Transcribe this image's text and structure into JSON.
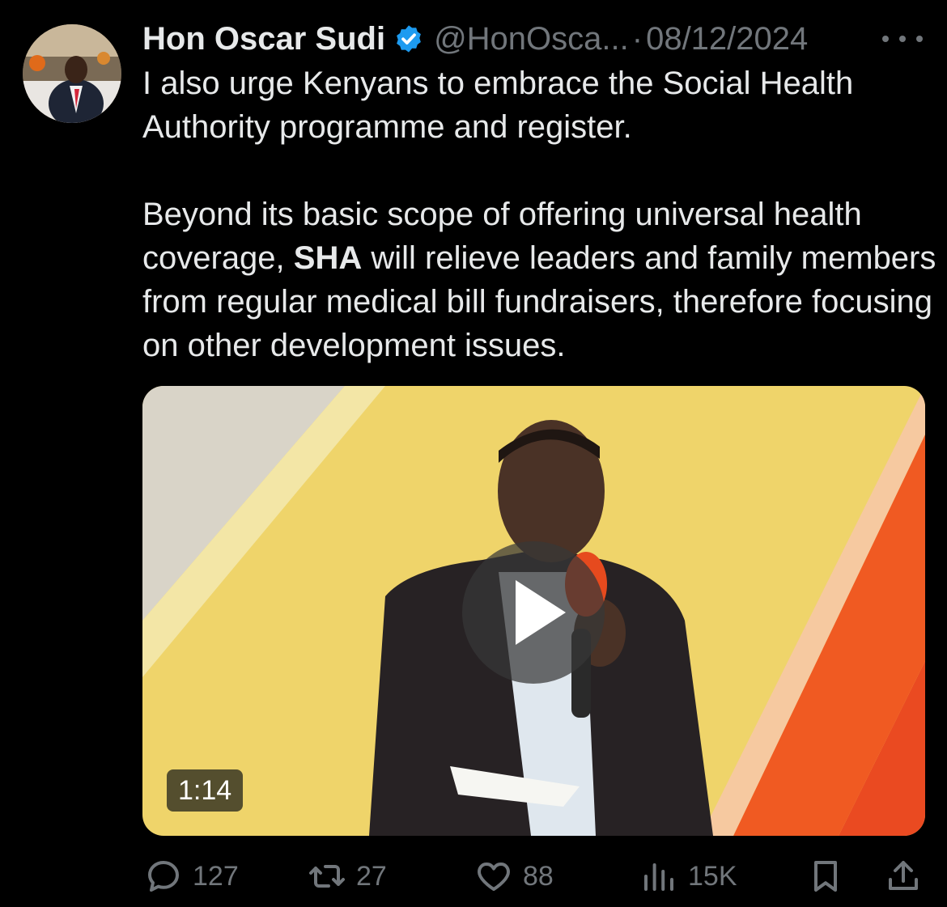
{
  "tweet": {
    "author_name": "Hon Oscar Sudi",
    "handle": "@HonOsca...",
    "separator": "·",
    "date": "08/12/2024",
    "text_paragraph_1": "I also urge Kenyans to embrace the Social Health Authority programme and register.",
    "text_paragraph_2_before": "Beyond its basic scope of offering universal health coverage, ",
    "text_paragraph_2_bold": "SHA",
    "text_paragraph_2_after": " will relieve leaders and family members from regular medical bill fundraisers, therefore focusing on other development issues."
  },
  "video": {
    "duration": "1:14"
  },
  "actions": {
    "replies": "127",
    "reposts": "27",
    "likes": "88",
    "views": "15K"
  },
  "colors": {
    "background": "#000000",
    "text": "#e7e9ea",
    "secondary": "#71767b",
    "verified": "#1d9bf0"
  },
  "icons": {
    "verified": "verified-badge-icon",
    "more": "more-dots-icon",
    "play": "play-icon",
    "reply": "reply-icon",
    "repost": "repost-icon",
    "like": "heart-icon",
    "views": "views-icon",
    "bookmark": "bookmark-icon",
    "share": "share-icon"
  }
}
